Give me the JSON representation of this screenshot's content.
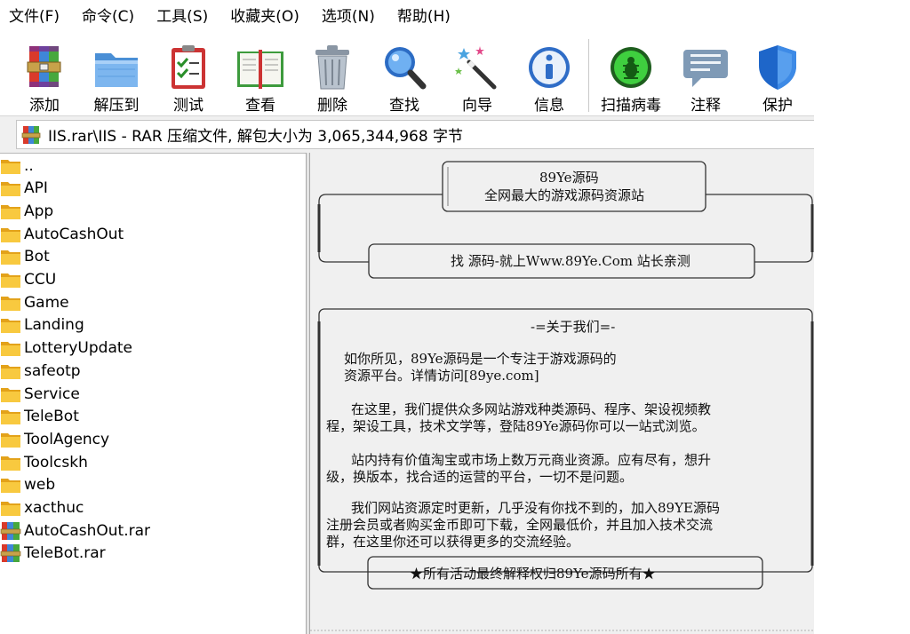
{
  "menu": [
    "文件(F)",
    "命令(C)",
    "工具(S)",
    "收藏夹(O)",
    "选项(N)",
    "帮助(H)"
  ],
  "toolbar": [
    {
      "label": "添加",
      "icon": "archive-add-icon"
    },
    {
      "label": "解压到",
      "icon": "extract-folder-icon"
    },
    {
      "label": "测试",
      "icon": "test-clipboard-icon"
    },
    {
      "label": "查看",
      "icon": "view-book-icon"
    },
    {
      "label": "删除",
      "icon": "trash-icon"
    },
    {
      "label": "查找",
      "icon": "magnifier-icon"
    },
    {
      "label": "向导",
      "icon": "wizard-wand-icon"
    },
    {
      "label": "信息",
      "icon": "info-icon"
    },
    {
      "label": "扫描病毒",
      "icon": "virus-scan-icon"
    },
    {
      "label": "注释",
      "icon": "comment-icon"
    },
    {
      "label": "保护",
      "icon": "shield-icon"
    }
  ],
  "address": {
    "text": "IIS.rar\\IIS - RAR 压缩文件, 解包大小为 3,065,344,968 字节",
    "icon": "rar-archive-icon"
  },
  "files": [
    {
      "name": "..",
      "type": "folder"
    },
    {
      "name": "API",
      "type": "folder"
    },
    {
      "name": "App",
      "type": "folder"
    },
    {
      "name": "AutoCashOut",
      "type": "folder"
    },
    {
      "name": "Bot",
      "type": "folder"
    },
    {
      "name": "CCU",
      "type": "folder"
    },
    {
      "name": "Game",
      "type": "folder"
    },
    {
      "name": "Landing",
      "type": "folder"
    },
    {
      "name": "LotteryUpdate",
      "type": "folder"
    },
    {
      "name": "safeotp",
      "type": "folder"
    },
    {
      "name": "Service",
      "type": "folder"
    },
    {
      "name": "TeleBot",
      "type": "folder"
    },
    {
      "name": "ToolAgency",
      "type": "folder"
    },
    {
      "name": "Toolcskh",
      "type": "folder"
    },
    {
      "name": "web",
      "type": "folder"
    },
    {
      "name": "xacthuc",
      "type": "folder"
    },
    {
      "name": "AutoCashOut.rar",
      "type": "rar"
    },
    {
      "name": "TeleBot.rar",
      "type": "rar"
    }
  ],
  "comment": {
    "box1_line1": "89Ye源码",
    "box1_line2": "全网最大的游戏源码资源站",
    "box2": "找 源码-就上Www.89Ye.Com 站长亲测",
    "about_title": "-=关于我们=-",
    "lines": [
      "如你所见，89Ye源码是一个专注于游戏源码的",
      "资源平台。详情访问[89ye.com]",
      "在这里，我们提供众多网站游戏种类源码、程序、架设视频教",
      "程，架设工具，技术文学等，登陆89Ye源码你可以一站式浏览。",
      "站内持有价值淘宝或市场上数万元商业资源。应有尽有，想升",
      "级，换版本，找合适的运营的平台，一切不是问题。",
      "我们网站资源定时更新，几乎没有你找不到的，加入89YE源码",
      "注册会员或者购买金币即可下载，全网最低价，并且加入技术交流",
      "群，在这里你还可以获得更多的交流经验。"
    ],
    "footer": "★所有活动最终解释权归89Ye源码所有★"
  }
}
